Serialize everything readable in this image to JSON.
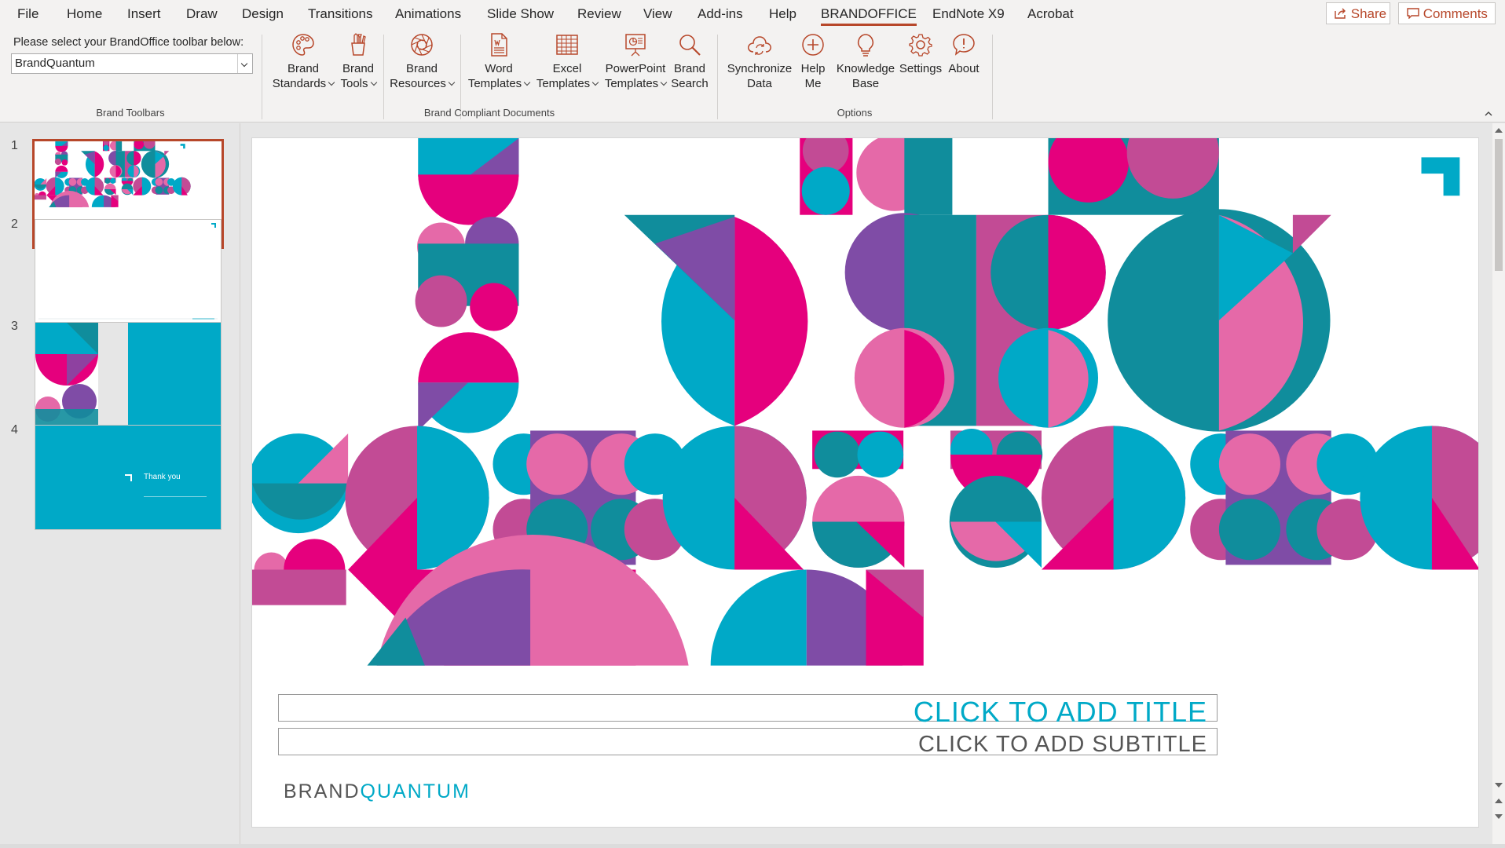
{
  "menu": {
    "items": [
      "File",
      "Home",
      "Insert",
      "Draw",
      "Design",
      "Transitions",
      "Animations",
      "Slide Show",
      "Review",
      "View",
      "Add-ins",
      "Help",
      "BRANDOFFICE",
      "EndNote X9",
      "Acrobat"
    ],
    "active": "BRANDOFFICE",
    "share_label": "Share",
    "comments_label": "Comments"
  },
  "ribbon": {
    "toolbar_select": {
      "label": "Please select your BrandOffice toolbar below:",
      "value": "BrandQuantum"
    },
    "groups": {
      "brand_toolbars": "Brand Toolbars",
      "brand_compliant": "Brand Compliant Documents",
      "options": "Options"
    },
    "buttons": {
      "brand_standards": {
        "line1": "Brand",
        "line2": "Standards",
        "icon": "palette-icon"
      },
      "brand_tools": {
        "line1": "Brand",
        "line2": "Tools",
        "icon": "pencil-cup-icon"
      },
      "brand_resources": {
        "line1": "Brand",
        "line2": "Resources",
        "icon": "aperture-icon"
      },
      "word_templates": {
        "line1": "Word",
        "line2": "Templates",
        "icon": "word-document-icon"
      },
      "excel_templates": {
        "line1": "Excel",
        "line2": "Templates",
        "icon": "spreadsheet-icon"
      },
      "powerpoint_templates": {
        "line1": "PowerPoint",
        "line2": "Templates",
        "icon": "presentation-icon"
      },
      "brand_search": {
        "line1": "Brand",
        "line2": "Search",
        "icon": "magnifier-icon"
      },
      "synchronize_data": {
        "line1": "Synchronize",
        "line2": "Data",
        "icon": "cloud-sync-icon"
      },
      "help_me": {
        "line1": "Help",
        "line2": "Me",
        "icon": "plus-circle-icon"
      },
      "knowledge_base": {
        "line1": "Knowledge",
        "line2": "Base",
        "icon": "lightbulb-icon"
      },
      "settings": {
        "line1": "Settings",
        "icon": "gear-icon"
      },
      "about": {
        "line1": "About",
        "icon": "speech-bubble-icon"
      }
    }
  },
  "thumbnails": {
    "slides": [
      {
        "number": "1",
        "selected": true
      },
      {
        "number": "2",
        "selected": false
      },
      {
        "number": "3",
        "selected": false
      },
      {
        "number": "4",
        "selected": false,
        "text": "Thank you"
      }
    ]
  },
  "slide": {
    "title_placeholder": "CLICK TO ADD TITLE",
    "subtitle_placeholder": "CLICK TO ADD SUBTITLE",
    "logo_part1": "BRAND",
    "logo_part2": "QUANTUM"
  },
  "colors": {
    "cyan": "#00a9c7",
    "magenta": "#e5007d",
    "purple": "#7f4ca6",
    "pink": "#e569a8",
    "teal": "#108d9c",
    "orchid": "#c24b95",
    "accent": "#b7472a"
  }
}
